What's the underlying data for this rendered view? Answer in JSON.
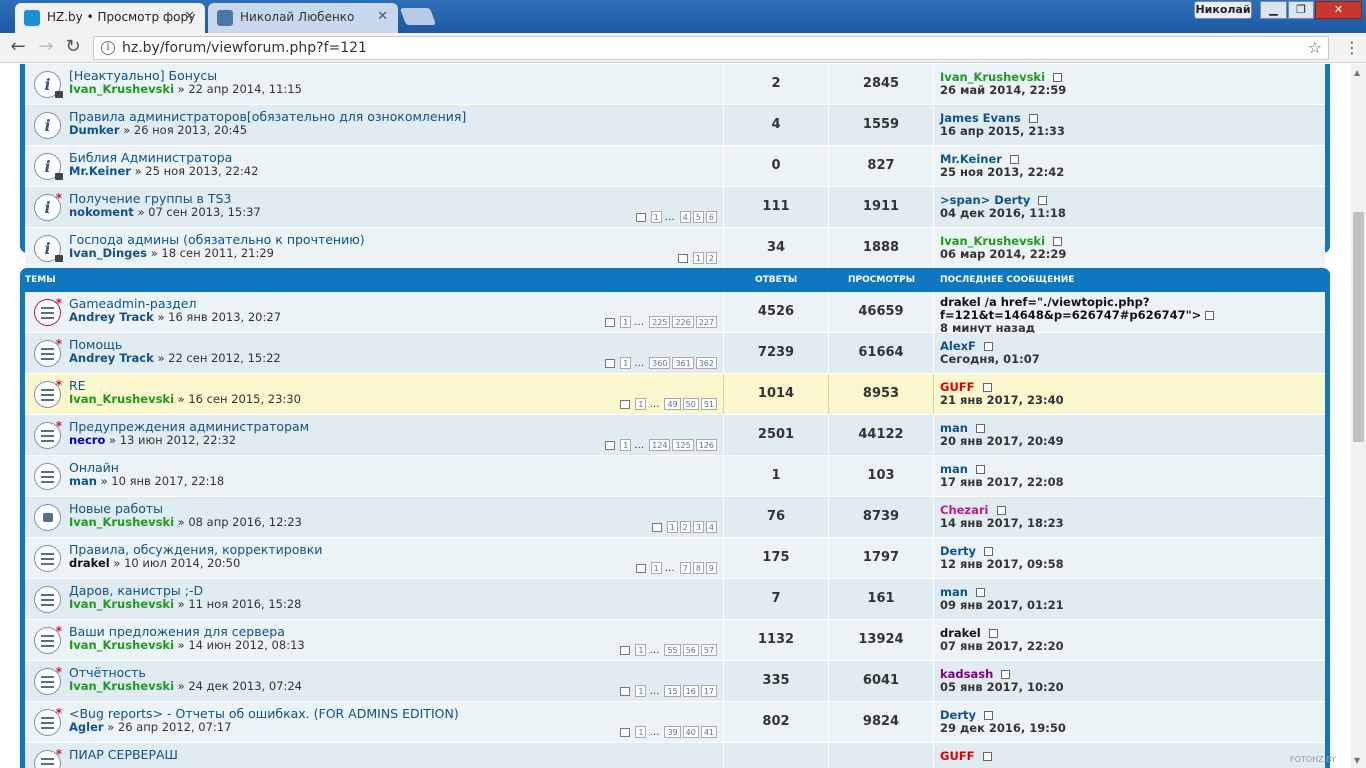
{
  "browser": {
    "tabs": [
      {
        "label": "HZ.by • Просмотр фору"
      },
      {
        "label": "Николай Любенко"
      }
    ],
    "user_name": "Николай",
    "url": "hz.by/forum/viewforum.php?f=121",
    "colors": {
      "chrome": "#1f5ea8",
      "forum_blue": "#0f76c0",
      "highlight": "#faf6cd"
    }
  },
  "announcements": [
    {
      "title": "[Неактуально] Бонусы",
      "author": "Ivan_Krushevski",
      "author_color": "green",
      "date": "» 22 апр 2014, 11:15",
      "replies": "2",
      "views": "2845",
      "last_author": "Ivan_Krushevski",
      "last_color": "green",
      "last_date": "26 май 2014, 22:59",
      "pages": [],
      "icon": "info-lock-icon"
    },
    {
      "title": "Правила администраторов[обязательно для ознокомления]",
      "author": "Dumker",
      "author_color": "",
      "date": "» 26 ноя 2013, 20:45",
      "replies": "4",
      "views": "1559",
      "last_author": "James Evans",
      "last_color": "",
      "last_date": "16 апр 2015, 21:33",
      "pages": [],
      "icon": "info-icon"
    },
    {
      "title": "Библия Администратора",
      "author": "Mr.Keiner",
      "author_color": "",
      "date": "» 25 ноя 2013, 22:42",
      "replies": "0",
      "views": "827",
      "last_author": "Mr.Keiner",
      "last_color": "",
      "last_date": "25 ноя 2013, 22:42",
      "pages": [],
      "icon": "info-lock-icon"
    },
    {
      "title": "Получение группы в TS3",
      "author": "nokoment",
      "author_color": "",
      "date": "» 07 сен 2013, 15:37",
      "replies": "111",
      "views": "1911",
      "last_author": ">span> Derty",
      "last_color": "",
      "last_date": "04 дек 2016, 11:18",
      "pages": [
        "1",
        "…",
        "4",
        "5",
        "6"
      ],
      "icon": "info-new-icon"
    },
    {
      "title": "Господа админы (обязательно к прочтению)",
      "author": "Ivan_Dinges",
      "author_color": "",
      "date": "» 18 сен 2011, 21:29",
      "replies": "34",
      "views": "1888",
      "last_author": "Ivan_Krushevski",
      "last_color": "green",
      "last_date": "06 мар 2014, 22:29",
      "pages": [
        "1",
        "2"
      ],
      "icon": "info-lock-icon"
    }
  ],
  "topics_header": {
    "topics": "ТЕМЫ",
    "replies": "ОТВЕТЫ",
    "views": "ПРОСМОТРЫ",
    "last_post": "ПОСЛЕДНЕЕ СООБЩЕНИЕ"
  },
  "topics": [
    {
      "title": "Gameadmin-раздел",
      "author": "Andrey Track",
      "author_color": "",
      "date": "» 16 янв 2013, 20:27",
      "replies": "4526",
      "views": "46659",
      "last_author": "drakel",
      "last_color": "black",
      "last_date": "8 минут назад",
      "last_extra": "/a href=\"./viewtopic.php?",
      "last_extra2": "f=121&t=14648&p=626747#p626747\">",
      "pages": [
        "1",
        "…",
        "225",
        "226",
        "227"
      ],
      "icon": "hot-topic-icon"
    },
    {
      "title": "Помощь",
      "author": "Andrey Track",
      "author_color": "",
      "date": "» 22 сен 2012, 15:22",
      "replies": "7239",
      "views": "61664",
      "last_author": "AlexF",
      "last_color": "",
      "last_date": "Сегодня, 01:07",
      "pages": [
        "1",
        "…",
        "360",
        "361",
        "362"
      ],
      "icon": "topic-new-icon"
    },
    {
      "title": "RE",
      "author": "Ivan_Krushevski",
      "author_color": "green",
      "date": "» 16 сен 2015, 23:30",
      "replies": "1014",
      "views": "8953",
      "last_author": "GUFF",
      "last_color": "red",
      "last_date": "21 янв 2017, 23:40",
      "pages": [
        "1",
        "…",
        "49",
        "50",
        "51"
      ],
      "icon": "topic-new-icon"
    },
    {
      "title": "Предупреждения администраторам",
      "author": "necro",
      "author_color": "blue",
      "date": "» 13 июн 2012, 22:32",
      "replies": "2501",
      "views": "44122",
      "last_author": "man",
      "last_color": "",
      "last_date": "20 янв 2017, 20:49",
      "pages": [
        "1",
        "…",
        "124",
        "125",
        "126"
      ],
      "icon": "topic-new-icon"
    },
    {
      "title": "Онлайн",
      "author": "man",
      "author_color": "",
      "date": "» 10 янв 2017, 22:18",
      "replies": "1",
      "views": "103",
      "last_author": "man",
      "last_color": "",
      "last_date": "17 янв 2017, 22:08",
      "pages": [],
      "icon": "topic-posted-icon"
    },
    {
      "title": "Новые работы",
      "author": "Ivan_Krushevski",
      "author_color": "green",
      "date": "» 08 апр 2016, 12:23",
      "replies": "76",
      "views": "8739",
      "last_author": "Chezari",
      "last_color": "pink",
      "last_date": "14 янв 2017, 18:23",
      "pages": [
        "1",
        "2",
        "3",
        "4"
      ],
      "icon": "locked-topic-icon"
    },
    {
      "title": "Правила, обсуждения, корректировки",
      "author": "drakel",
      "author_color": "black",
      "date": "» 10 июл 2014, 20:50",
      "replies": "175",
      "views": "1797",
      "last_author": "Derty",
      "last_color": "",
      "last_date": "12 янв 2017, 09:58",
      "pages": [
        "1",
        "…",
        "7",
        "8",
        "9"
      ],
      "icon": "topic-icon"
    },
    {
      "title": "Даров, канистры ;-D",
      "author": "Ivan_Krushevski",
      "author_color": "green",
      "date": "» 11 ноя 2016, 15:28",
      "replies": "7",
      "views": "161",
      "last_author": "man",
      "last_color": "",
      "last_date": "09 янв 2017, 01:21",
      "pages": [],
      "icon": "topic-icon"
    },
    {
      "title": "Ваши предложения для сервера",
      "author": "Ivan_Krushevski",
      "author_color": "green",
      "date": "» 14 июн 2012, 08:13",
      "replies": "1132",
      "views": "13924",
      "last_author": "drakel",
      "last_color": "black",
      "last_date": "07 янв 2017, 22:20",
      "pages": [
        "1",
        "…",
        "55",
        "56",
        "57"
      ],
      "icon": "topic-new-icon"
    },
    {
      "title": "Отчётность",
      "author": "Ivan_Krushevski",
      "author_color": "green",
      "date": "» 24 дек 2013, 07:24",
      "replies": "335",
      "views": "6041",
      "last_author": "kadsash",
      "last_color": "purple",
      "last_date": "05 янв 2017, 10:20",
      "pages": [
        "1",
        "…",
        "15",
        "16",
        "17"
      ],
      "icon": "topic-new-icon"
    },
    {
      "title": "<Bug reports> - Отчеты об ошибках. (FOR ADMINS EDITION)",
      "author": "Agler",
      "author_color": "",
      "date": "» 26 апр 2012, 07:17",
      "replies": "802",
      "views": "9824",
      "last_author": "Derty",
      "last_color": "",
      "last_date": "29 дек 2016, 19:50",
      "pages": [
        "1",
        "…",
        "39",
        "40",
        "41"
      ],
      "icon": "topic-new-icon"
    },
    {
      "title": "ПИАР СЕРВЕРАШ",
      "author": "",
      "author_color": "",
      "date": "",
      "replies": "",
      "views": "",
      "last_author": "GUFF",
      "last_color": "red",
      "last_date": "",
      "pages": [],
      "icon": "topic-new-icon"
    }
  ],
  "watermark": "FOTOHZ.BY"
}
